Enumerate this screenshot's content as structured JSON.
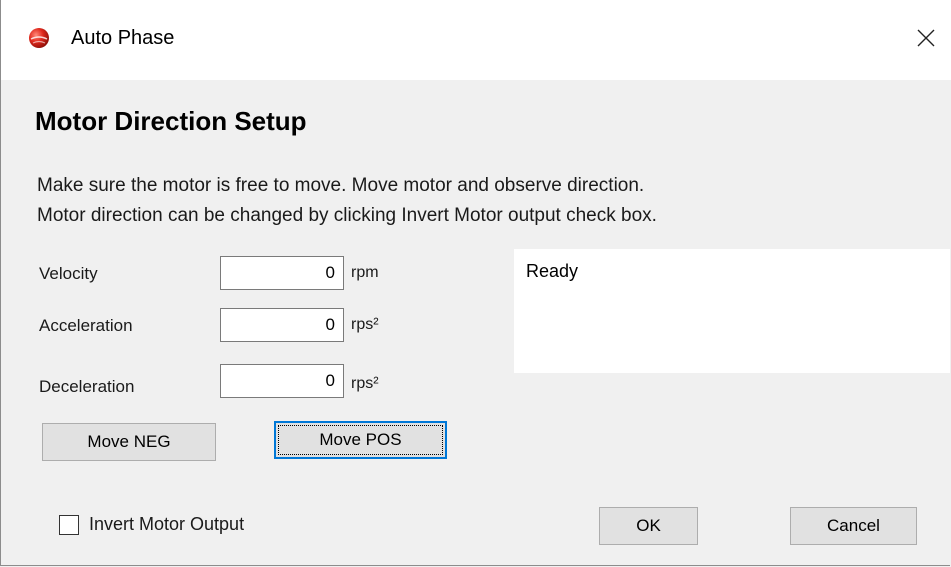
{
  "window": {
    "title": "Auto Phase",
    "close_glyph": "✕"
  },
  "heading": "Motor Direction Setup",
  "description": {
    "line1": "Make sure the motor is free to move.  Move motor and observe direction.",
    "line2": "Motor direction can be changed by clicking Invert Motor output check box."
  },
  "fields": {
    "velocity": {
      "label": "Velocity",
      "value": "0",
      "unit": "rpm"
    },
    "acceleration": {
      "label": "Acceleration",
      "value": "0",
      "unit": "rps²"
    },
    "deceleration": {
      "label": "Deceleration",
      "value": "0",
      "unit": "rps²"
    }
  },
  "status": "Ready",
  "buttons": {
    "move_neg": "Move NEG",
    "move_pos": "Move POS",
    "ok": "OK",
    "cancel": "Cancel"
  },
  "invert": {
    "label": "Invert Motor Output",
    "checked": false
  }
}
